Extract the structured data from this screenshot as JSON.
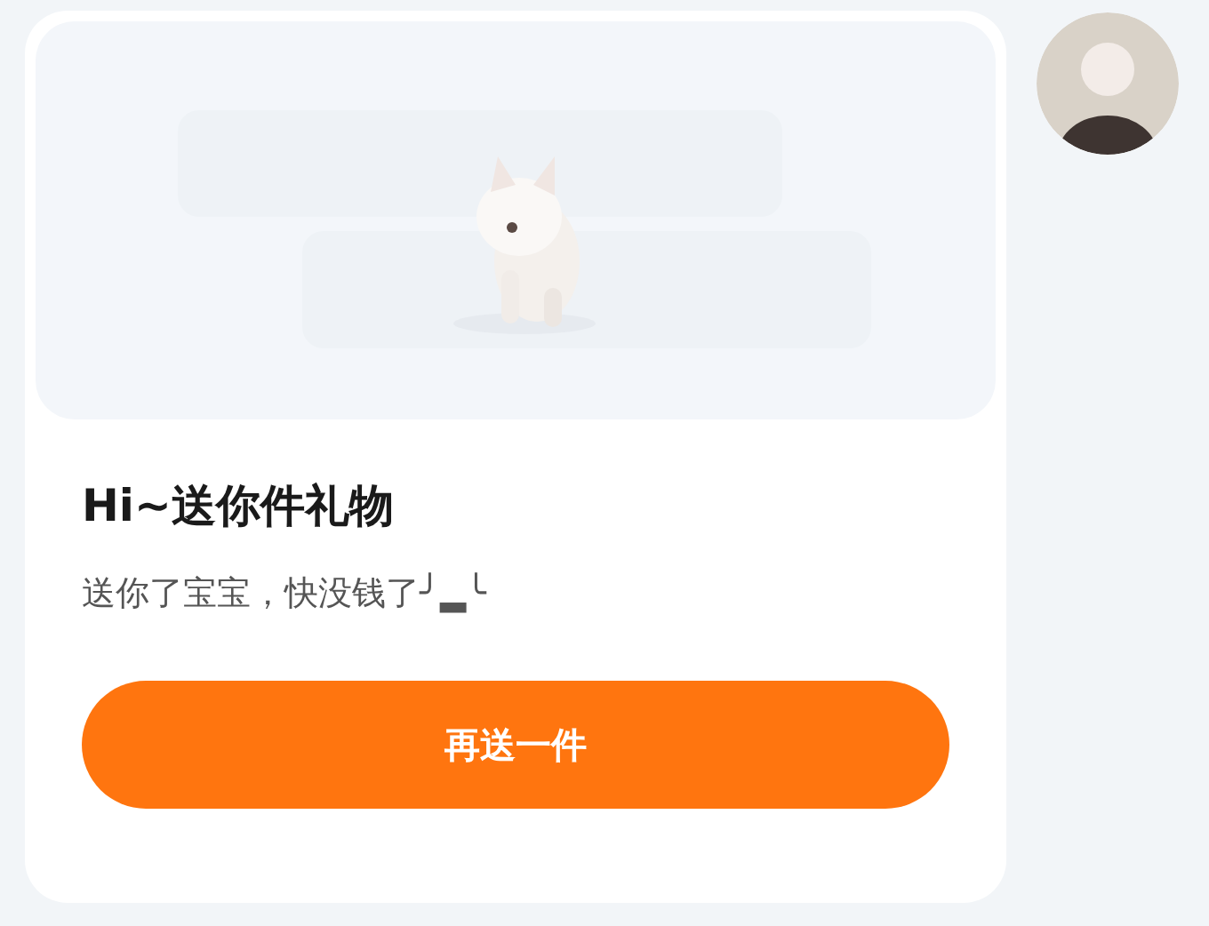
{
  "gift_card": {
    "title": "Hi~送你件礼物",
    "message": "送你了宝宝，快没钱了╯▂╰",
    "button": "再送一件"
  }
}
